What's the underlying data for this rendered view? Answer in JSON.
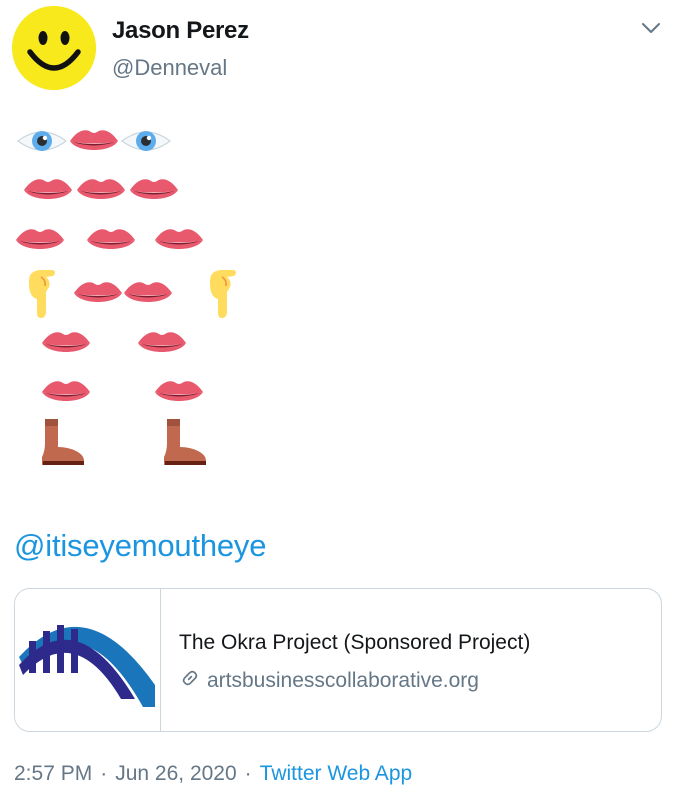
{
  "tweet": {
    "author": {
      "display_name": "Jason Perez",
      "handle": "@Denneval",
      "avatar_icon": "smiley-face-icon"
    },
    "menu_icon": "chevron-down-icon",
    "emoji_art": [
      [
        "eye",
        "lips",
        "eye"
      ],
      [
        "lips",
        "lips",
        "lips"
      ],
      [
        "lips",
        "lips",
        "lips"
      ],
      [
        "pointing-finger",
        "lips",
        "lips",
        "pointing-finger"
      ],
      [
        "lips",
        "lips"
      ],
      [
        "lips",
        "lips"
      ],
      [
        "boot",
        "boot"
      ]
    ],
    "mention": "@itiseyemoutheye",
    "card": {
      "image_icon": "bridge-logo-icon",
      "title": "The Okra Project (Sponsored Project)",
      "domain": "artsbusinesscollaborative.org",
      "link_icon": "link-icon"
    },
    "meta": {
      "time": "2:57 PM",
      "separator": "·",
      "date": "Jun 26, 2020",
      "source": "Twitter Web App"
    }
  },
  "colors": {
    "link": "#1b95e0",
    "secondary_text": "#657786",
    "primary_text": "#14171a",
    "border": "#ccd6dd",
    "avatar_bg": "#f7e91c",
    "lips": "#e8596e",
    "boot": "#c1694f",
    "finger": "#ffdc5d",
    "eye_iris": "#5dadec",
    "bridge_navy": "#2d2a8c",
    "bridge_blue": "#1b75bb"
  }
}
